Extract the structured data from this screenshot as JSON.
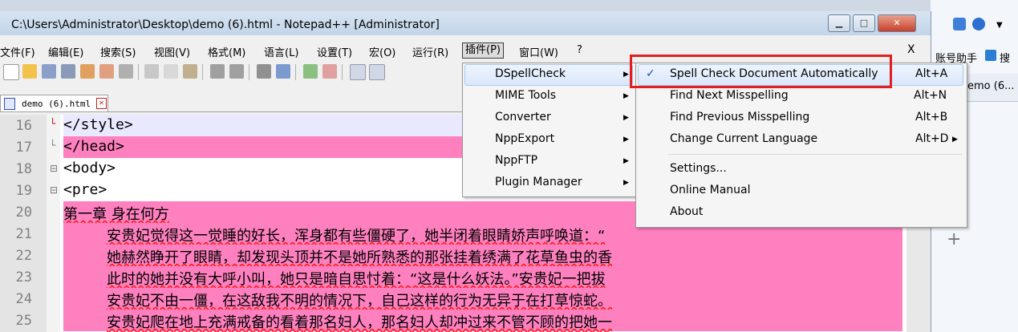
{
  "window": {
    "title": "C:\\Users\\Administrator\\Desktop\\demo (6).html - Notepad++ [Administrator]"
  },
  "menubar": {
    "items": [
      "文件(F)",
      "编辑(E)",
      "搜索(S)",
      "视图(V)",
      "格式(M)",
      "语言(L)",
      "设置(T)",
      "宏(O)",
      "运行(R)",
      "插件(P)",
      "窗口(W)",
      "?"
    ],
    "close": "X"
  },
  "tab": {
    "label": "demo (6).html"
  },
  "editor": {
    "lines": [
      {
        "num": "16",
        "text": "</style>"
      },
      {
        "num": "17",
        "text": "</head>"
      },
      {
        "num": "18",
        "text": "<body>"
      },
      {
        "num": "19",
        "text": "<pre>"
      },
      {
        "num": "20",
        "text": "第一章 身在何方"
      },
      {
        "num": "21",
        "text": "安贵妃觉得这一觉睡的好长，浑身都有些僵硬了，她半闭着眼睛娇声呼唤道：“"
      },
      {
        "num": "22",
        "text": "她赫然睁开了眼睛，却发现头顶并不是她所熟悉的那张挂着绣满了花草鱼虫的香"
      },
      {
        "num": "23",
        "text": "此时的她并没有大呼小叫，她只是暗自思忖着：“这是什么妖法。”安贵妃一把拔"
      },
      {
        "num": "24",
        "text": "安贵妃不由一僵，在这敌我不明的情况下，自己这样的行为无异于在打草惊蛇。"
      },
      {
        "num": "25",
        "text": "安贵妃爬在地上充满戒备的看着那名妇人，那名妇人却冲过来不管不顾的把她一"
      }
    ]
  },
  "plugin_menu": {
    "items": [
      {
        "label": "DSpellCheck",
        "submenu": true
      },
      {
        "label": "MIME Tools",
        "submenu": true
      },
      {
        "label": "Converter",
        "submenu": true
      },
      {
        "label": "NppExport",
        "submenu": true
      },
      {
        "label": "NppFTP",
        "submenu": true
      },
      {
        "label": "Plugin Manager",
        "submenu": true
      }
    ]
  },
  "dspell_menu": {
    "items": [
      {
        "label": "Spell Check Document Automatically",
        "shortcut": "Alt+A",
        "checked": "✓"
      },
      {
        "label": "Find Next Misspelling",
        "shortcut": "Alt+N"
      },
      {
        "label": "Find Previous Misspelling",
        "shortcut": "Alt+B"
      },
      {
        "label": "Change Current Language",
        "shortcut": "Alt+D"
      },
      {
        "label": "Settings..."
      },
      {
        "label": "Online Manual"
      },
      {
        "label": "About"
      }
    ]
  },
  "right_panel": {
    "toolbar_text": "账号助手",
    "search_text": "搜",
    "tab_text": "emo (6...",
    "plus": "+"
  },
  "colors": {
    "highlight": "#ff80bf",
    "accent_red": "#e41e1e",
    "selection": "#dae8fb"
  }
}
